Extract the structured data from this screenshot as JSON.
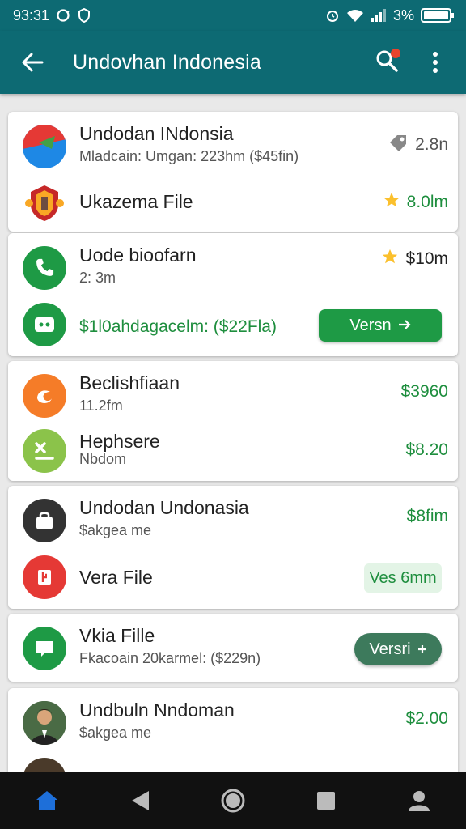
{
  "status_bar": {
    "time": "93:31",
    "battery": "3%"
  },
  "app_bar": {
    "title": "Undovhan Indonesia",
    "icons": [
      "back-arrow-icon",
      "search-icon",
      "more-vert-icon"
    ],
    "colors": {
      "primary": "#0d6a73",
      "notification": "#e8442d"
    }
  },
  "cards": [
    {
      "rows": [
        {
          "title": "Undodan INdonsia",
          "subtitle": "Mladcain: Umgan: 223hm ($‌45fin)",
          "right": "2.8n",
          "icon": "tag-icon",
          "avatar": "flag-icon"
        },
        {
          "title": "Ukazema File",
          "right": "8.0lm",
          "icon": "star-icon",
          "avatar": "crest-icon"
        }
      ]
    },
    {
      "rows": [
        {
          "title": "Uode bioofarn",
          "subtitle": "2: 3m",
          "right": "$10m",
          "icon": "star-icon",
          "avatar": "phone-icon"
        },
        {
          "subtitle": "$1‌l0ahdagacelm: ($22Fla)",
          "button": "Versn",
          "avatar": "chat-icon"
        }
      ]
    },
    {
      "rows": [
        {
          "title": "Beclishfiaan",
          "subtitle": "11.2fm",
          "right": "$3960",
          "avatar": "orange-app-icon"
        },
        {
          "title": "Hephsere",
          "subtitle": "Nbdom",
          "right": "$8.20",
          "avatar": "lime-app-icon"
        }
      ]
    },
    {
      "rows": [
        {
          "title": "Undodan Undonasia",
          "subtitle": "$akgea me",
          "right": "$8fim",
          "avatar": "bag-icon"
        },
        {
          "title": "Vera File",
          "pill": "Ves 6mm",
          "avatar": "red-app-icon"
        }
      ]
    },
    {
      "rows": [
        {
          "title": "Vkia Fille",
          "subtitle": "Fkacoain 20karmel: ($229n)",
          "button": "Versri",
          "avatar": "message-icon"
        }
      ]
    },
    {
      "rows": [
        {
          "title": "Undbuln Nndoman",
          "subtitle": "$akgea me",
          "right": "$2.00",
          "avatar": "person-photo"
        }
      ]
    }
  ],
  "nav_bar": {
    "items": [
      "home-icon",
      "back-triangle-icon",
      "home-circle-icon",
      "recents-square-icon",
      "profile-icon"
    ]
  }
}
